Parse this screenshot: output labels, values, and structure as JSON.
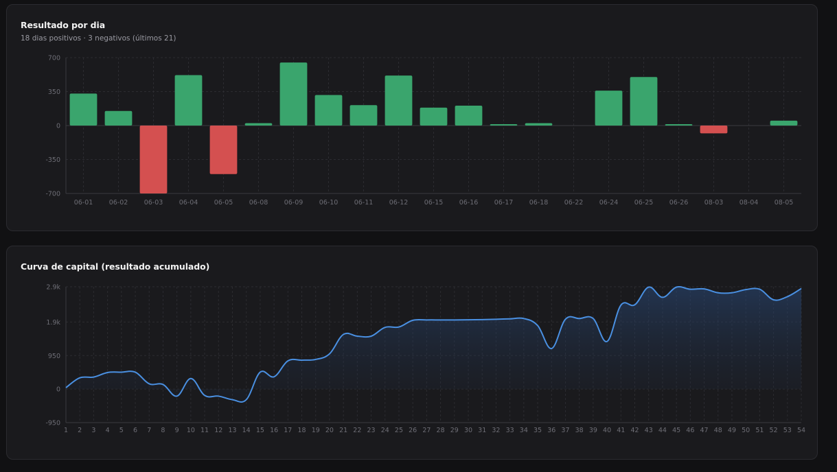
{
  "colors": {
    "positive": "#3aa56d",
    "negative": "#d45050",
    "line": "#4a90e2",
    "grid": "#2c2c31",
    "card": "#1a1a1d",
    "background": "#111113"
  },
  "daily": {
    "title": "Resultado por dia",
    "subtitle": "18 dias positivos · 3 negativos (últimos 21)"
  },
  "equity": {
    "title": "Curva de capital (resultado acumulado)"
  },
  "chart_data": [
    {
      "type": "bar",
      "title": "Resultado por dia",
      "subtitle": "18 dias positivos · 3 negativos (últimos 21)",
      "categories": [
        "06-01",
        "06-02",
        "06-03",
        "06-04",
        "06-05",
        "06-08",
        "06-09",
        "06-10",
        "06-11",
        "06-12",
        "06-15",
        "06-16",
        "06-17",
        "06-18",
        "06-22",
        "06-24",
        "06-25",
        "06-26",
        "08-03",
        "08-04",
        "08-05"
      ],
      "values": [
        330,
        150,
        -700,
        520,
        -500,
        25,
        650,
        315,
        210,
        515,
        185,
        205,
        10,
        25,
        0,
        360,
        500,
        8,
        -80,
        0,
        50
      ],
      "ylim": [
        -700,
        700
      ],
      "yticks": [
        700,
        350,
        0,
        -350,
        -700
      ],
      "ytick_labels": [
        "700",
        "350",
        "0",
        "-350",
        "-700"
      ],
      "grid": true
    },
    {
      "type": "area",
      "title": "Curva de capital (resultado acumulado)",
      "x": [
        1,
        2,
        3,
        4,
        5,
        6,
        7,
        8,
        9,
        10,
        11,
        12,
        13,
        14,
        15,
        16,
        17,
        18,
        19,
        20,
        21,
        22,
        23,
        24,
        25,
        26,
        27,
        28,
        29,
        30,
        31,
        32,
        33,
        34,
        35,
        36,
        37,
        38,
        39,
        40,
        41,
        42,
        43,
        44,
        45,
        46,
        47,
        48,
        49,
        50,
        51,
        52,
        53,
        54
      ],
      "values": [
        40,
        320,
        340,
        470,
        480,
        480,
        150,
        130,
        -200,
        300,
        -180,
        -200,
        -300,
        -300,
        480,
        350,
        800,
        820,
        840,
        1000,
        1550,
        1500,
        1500,
        1750,
        1760,
        1950,
        1960,
        1960,
        1960,
        1965,
        1970,
        1980,
        1990,
        2000,
        1800,
        1150,
        1980,
        2000,
        2000,
        1350,
        2380,
        2390,
        2890,
        2600,
        2890,
        2830,
        2840,
        2730,
        2730,
        2820,
        2830,
        2530,
        2620,
        2850
      ],
      "ylim": [
        -950,
        2900
      ],
      "yticks": [
        2900,
        1900,
        950,
        0,
        -950
      ],
      "ytick_labels": [
        "2.9k",
        "1.9k",
        "950",
        "0",
        "-950"
      ],
      "grid": true
    }
  ]
}
